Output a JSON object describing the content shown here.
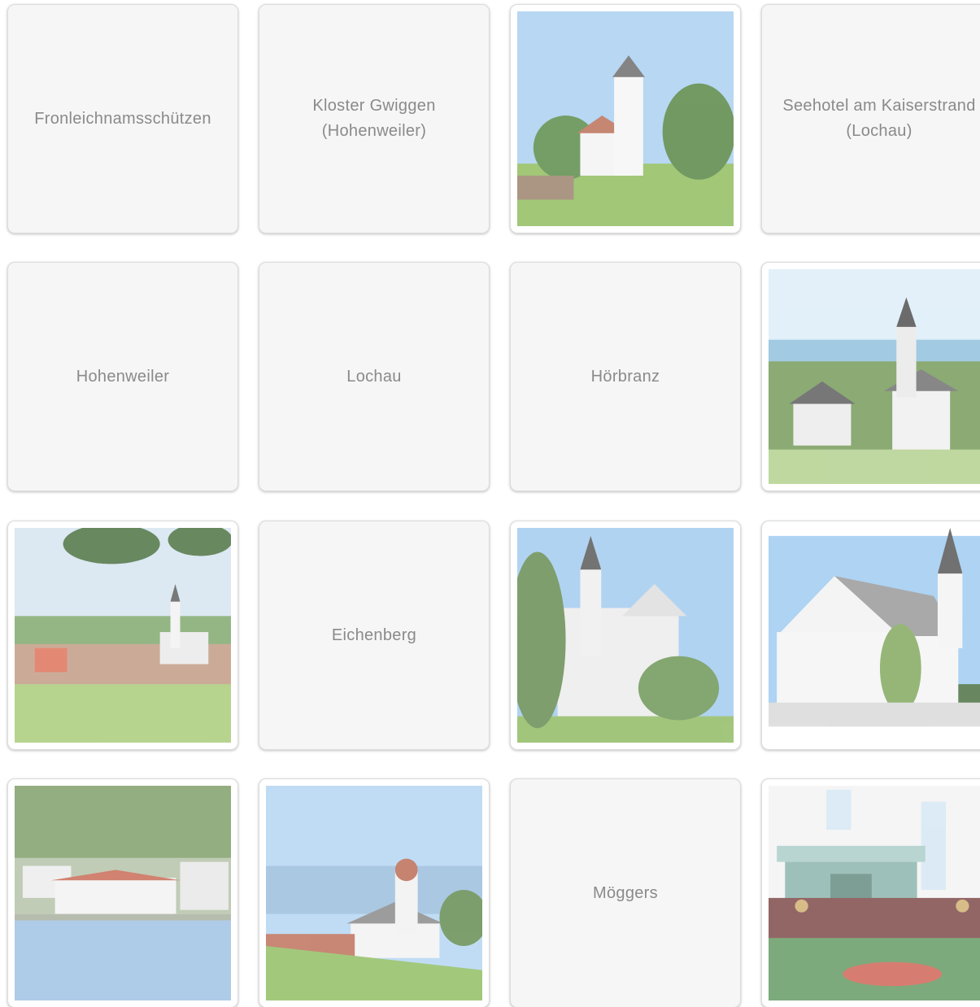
{
  "tiles": {
    "fronleichnamsschuetzen": "Fronleichnamsschützen",
    "kloster_gwiggen": "Kloster Gwiggen\n(Hohenweiler)",
    "seehotel": "Seehotel am Kaiserstrand\n(Lochau)",
    "hohenweiler": "Hohenweiler",
    "lochau": "Lochau",
    "hoerbranz": "Hörbranz",
    "eichenberg": "Eichenberg",
    "moeggers": "Möggers"
  },
  "photos": [
    {
      "id": "chapel-tower",
      "icon": "chapel-photo"
    },
    {
      "id": "village-church-lake",
      "icon": "village-church-photo"
    },
    {
      "id": "village-meadow",
      "icon": "village-meadow-photo"
    },
    {
      "id": "church-facade-trees",
      "icon": "church-facade-photo"
    },
    {
      "id": "white-church-steeple",
      "icon": "white-church-photo"
    },
    {
      "id": "lakeside-hotel",
      "icon": "lakeside-hotel-photo"
    },
    {
      "id": "hilltop-chapel-lake",
      "icon": "hilltop-chapel-photo"
    },
    {
      "id": "procession-parade",
      "icon": "procession-photo"
    }
  ],
  "colors": {
    "sky": "#a9cff0",
    "grass": "#8cbf4f",
    "tile_bg": "#f6f6f6",
    "label": "#8a8a8a"
  }
}
